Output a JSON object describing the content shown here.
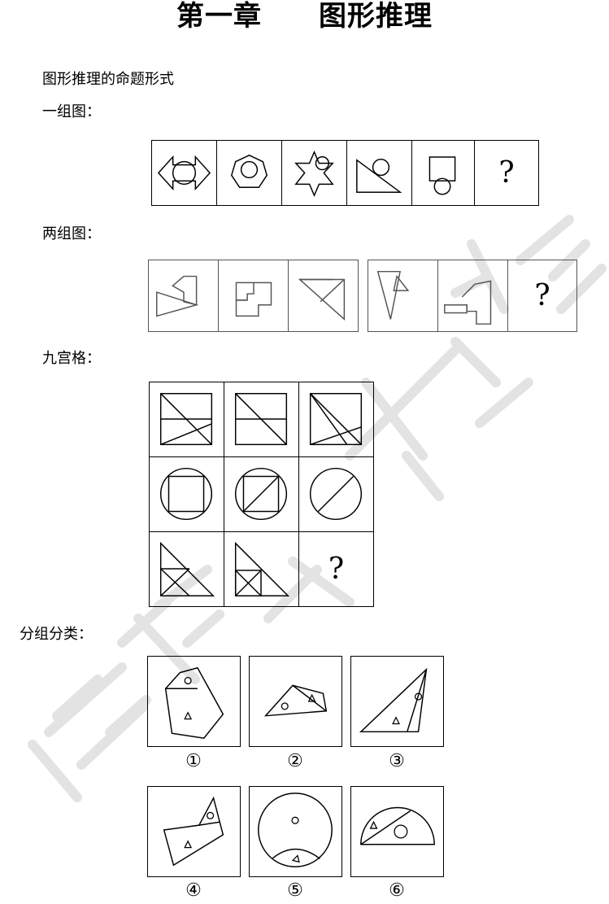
{
  "header": {
    "title": "第一章　　图形推理"
  },
  "section": {
    "intro": "图形推理的命题形式"
  },
  "labels": {
    "one_group": "一组图：",
    "two_group": "两组图：",
    "nine_grid": "九宫格：",
    "grouping": "分组分类："
  },
  "question_mark": "?",
  "grouping_numbers": [
    "①",
    "②",
    "③",
    "④",
    "⑤",
    "⑥"
  ],
  "watermark": {
    "text": "宝藏冬文超in",
    "color": "#d9d9d9"
  }
}
